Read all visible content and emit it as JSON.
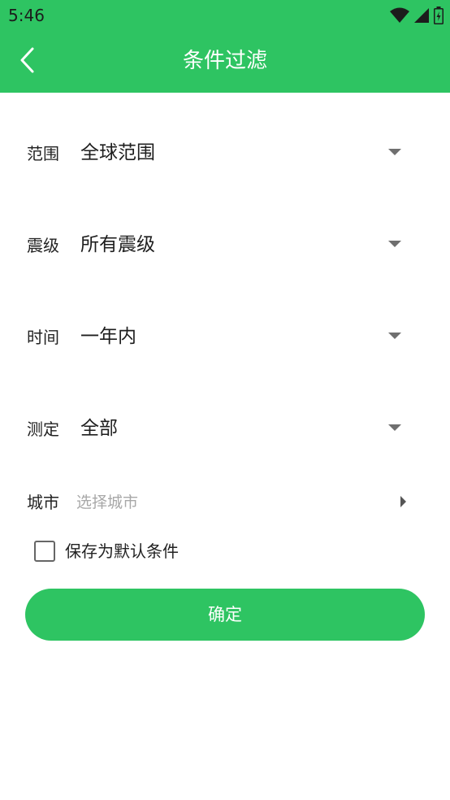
{
  "status_bar": {
    "time": "5:46",
    "icons": [
      "wifi-icon",
      "signal-icon",
      "battery-icon"
    ]
  },
  "app_bar": {
    "title": "条件过滤",
    "back_icon": "chevron-left-icon"
  },
  "filters": [
    {
      "label": "范围",
      "value": "全球范围"
    },
    {
      "label": "震级",
      "value": "所有震级"
    },
    {
      "label": "时间",
      "value": "一年内"
    },
    {
      "label": "测定",
      "value": "全部"
    }
  ],
  "city": {
    "label": "城市",
    "placeholder": "选择城市"
  },
  "save_default": {
    "label": "保存为默认条件",
    "checked": false
  },
  "confirm_button": {
    "label": "确定"
  },
  "colors": {
    "primary": "#2ec462",
    "text": "#222222",
    "placeholder": "#a8a8a8"
  }
}
